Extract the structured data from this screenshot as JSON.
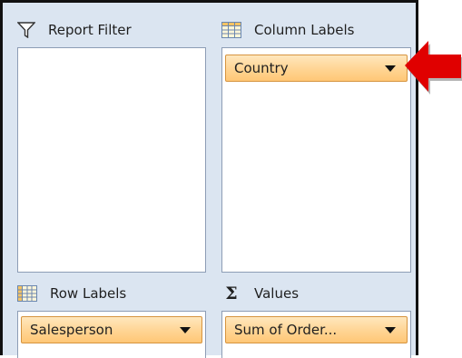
{
  "report_filter": {
    "title": "Report Filter",
    "icon": "filter-icon",
    "items": []
  },
  "column_labels": {
    "title": "Column Labels",
    "icon": "column-grid-icon",
    "items": [
      {
        "label": "Country"
      }
    ]
  },
  "row_labels": {
    "title": "Row Labels",
    "icon": "row-grid-icon",
    "items": [
      {
        "label": "Salesperson"
      }
    ]
  },
  "values": {
    "title": "Values",
    "icon": "sigma-icon",
    "items": [
      {
        "label": "Sum of Order..."
      }
    ]
  },
  "colors": {
    "panel_bg": "#dbe5f1",
    "field_fill": "#ffd493",
    "field_border": "#d6943f",
    "arrow": "#e00000"
  }
}
